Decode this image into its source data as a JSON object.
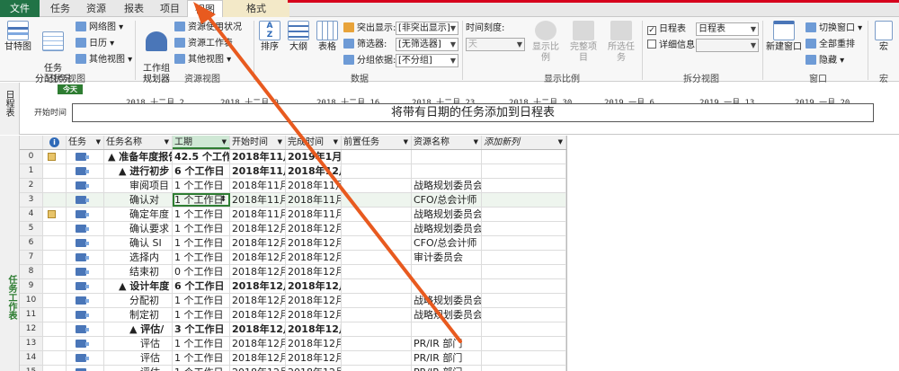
{
  "tabs": {
    "file": "文件",
    "task": "任务",
    "resource": "资源",
    "report": "报表",
    "project": "项目",
    "view": "视图",
    "format": "格式"
  },
  "ribbon": {
    "task_views": {
      "group_label": "任务视图",
      "gantt": "甘特图",
      "task_usage": "任务\n分配状况",
      "network": "网络图",
      "calendar": "日历",
      "other_views": "其他视图"
    },
    "resource_views": {
      "group_label": "资源视图",
      "team_planner": "工作组\n规划器",
      "resource_usage": "资源使用状况",
      "resource_sheet": "资源工作表",
      "other_views": "其他视图"
    },
    "data": {
      "group_label": "数据",
      "sort": "排序",
      "outline": "大纲",
      "tables": "表格",
      "highlight_label": "突出显示:",
      "highlight_value": "[非突出显示]",
      "filter_label": "筛选器:",
      "filter_value": "[无筛选器]",
      "group_label2": "分组依据:",
      "group_value": "[不分组]"
    },
    "zoom": {
      "group_label": "显示比例",
      "timescale_label": "时间刻度:",
      "timescale_value": "天",
      "zoom": "显示比例",
      "entire_project": "完整项目",
      "selected_tasks": "所选任务"
    },
    "split_view": {
      "group_label": "拆分视图",
      "timeline_label": "日程表",
      "timeline_value": "日程表",
      "details_label": "详细信息"
    },
    "window": {
      "group_label": "窗口",
      "new_window": "新建窗口",
      "switch_window": "切换窗口",
      "arrange_all": "全部重排",
      "hide": "隐藏"
    },
    "macros": {
      "group_label": "宏",
      "macros": "宏"
    }
  },
  "timeline": {
    "side_label": "日程表",
    "today": "今天",
    "start_label": "开始时间",
    "placeholder": "将带有日期的任务添加到日程表",
    "dates": [
      "2018 十二月 2",
      "2018 十二月 9",
      "2018 十二月 16",
      "2018 十二月 23",
      "2018 十二月 30",
      "2019 一月 6",
      "2019 一月 13",
      "2019 一月 20"
    ]
  },
  "grid": {
    "side_label": "任务工作表",
    "headers": {
      "info": "i",
      "mode": "任务",
      "name": "任务名称",
      "duration": "工期",
      "start": "开始时间",
      "finish": "完成时间",
      "predecessors": "前置任务",
      "resources": "资源名称",
      "add_column": "添加新列"
    },
    "rows": [
      {
        "id": "0",
        "name": "▲ 准备年度报告",
        "duration": "42.5 个工作日",
        "start": "2018年11月",
        "finish": "2019年1月2",
        "pred": "",
        "res": "",
        "bold": true,
        "indent": 0,
        "note": true
      },
      {
        "id": "1",
        "name": "▲ 进行初步",
        "duration": "6 个工作日",
        "start": "2018年11月",
        "finish": "2018年12月",
        "pred": "",
        "res": "",
        "bold": true,
        "indent": 1,
        "note": false
      },
      {
        "id": "2",
        "name": "审阅项目",
        "duration": "1 个工作日",
        "start": "2018年11月",
        "finish": "2018年11月",
        "pred": "",
        "res": "战略规划委员会",
        "bold": false,
        "indent": 2,
        "note": false
      },
      {
        "id": "3",
        "name": "确认对",
        "duration": "1 个工作日",
        "start": "2018年11月",
        "finish": "2018年11月2",
        "pred": "",
        "res": "CFO/总会计师",
        "bold": false,
        "indent": 2,
        "note": false
      },
      {
        "id": "4",
        "name": "确定年度",
        "duration": "1 个工作日",
        "start": "2018年11月",
        "finish": "2018年11月3",
        "pred": "",
        "res": "战略规划委员会",
        "bold": false,
        "indent": 2,
        "note": true
      },
      {
        "id": "5",
        "name": "确认要求",
        "duration": "1 个工作日",
        "start": "2018年12月",
        "finish": "2018年12月4",
        "pred": "",
        "res": "战略规划委员会",
        "bold": false,
        "indent": 2,
        "note": false
      },
      {
        "id": "6",
        "name": "确认 SI",
        "duration": "1 个工作日",
        "start": "2018年12月",
        "finish": "2018年12月5",
        "pred": "",
        "res": "CFO/总会计师",
        "bold": false,
        "indent": 2,
        "note": false
      },
      {
        "id": "7",
        "name": "选择内",
        "duration": "1 个工作日",
        "start": "2018年12月",
        "finish": "2018年12月6",
        "pred": "",
        "res": "审计委员会",
        "bold": false,
        "indent": 2,
        "note": false
      },
      {
        "id": "8",
        "name": "结束初",
        "duration": "0 个工作日",
        "start": "2018年12月",
        "finish": "2018年12月7",
        "pred": "",
        "res": "",
        "bold": false,
        "indent": 2,
        "note": false
      },
      {
        "id": "9",
        "name": "▲ 设计年度",
        "duration": "6 个工作日",
        "start": "2018年12月",
        "finish": "2018年12月",
        "pred": "",
        "res": "",
        "bold": true,
        "indent": 1,
        "note": false
      },
      {
        "id": "10",
        "name": "分配初",
        "duration": "1 个工作日",
        "start": "2018年12月",
        "finish": "2018年12月8",
        "pred": "",
        "res": "战略规划委员会",
        "bold": false,
        "indent": 2,
        "note": false
      },
      {
        "id": "11",
        "name": "制定初",
        "duration": "1 个工作日",
        "start": "2018年12月",
        "finish": "2018年12月10",
        "pred": "",
        "res": "战略规划委员会",
        "bold": false,
        "indent": 2,
        "note": false
      },
      {
        "id": "12",
        "name": "▲ 评估/",
        "duration": "3 个工作日",
        "start": "2018年12月",
        "finish": "2018年12月",
        "pred": "",
        "res": "",
        "bold": true,
        "indent": 2,
        "note": false
      },
      {
        "id": "13",
        "name": "评估",
        "duration": "1 个工作日",
        "start": "2018年12月",
        "finish": "2018年12月11",
        "pred": "",
        "res": "PR/IR 部门",
        "bold": false,
        "indent": 3,
        "note": false
      },
      {
        "id": "14",
        "name": "评估",
        "duration": "1 个工作日",
        "start": "2018年12月",
        "finish": "2018年12月13",
        "pred": "",
        "res": "PR/IR 部门",
        "bold": false,
        "indent": 3,
        "note": false
      },
      {
        "id": "15",
        "name": "评估",
        "duration": "1 个工作日",
        "start": "2018年12月",
        "finish": "2018年12月14",
        "pred": "",
        "res": "PR/IR 部门",
        "bold": false,
        "indent": 3,
        "note": false
      }
    ]
  },
  "colors": {
    "file_tab": "#217346",
    "accent_red": "#d6001c",
    "today_green": "#2e7d32",
    "task_icon": "#4a76b8"
  }
}
